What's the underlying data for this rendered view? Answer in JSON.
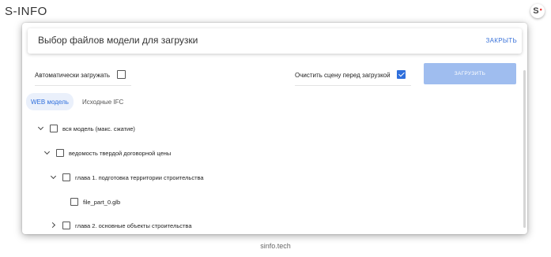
{
  "app": {
    "title": "S-INFO",
    "logo_letter": "S",
    "logo_dot": "•",
    "footer": "sinfo.tech"
  },
  "dialog": {
    "title": "Выбор файлов модели для загрузки",
    "close_label": "ЗАКРЫТЬ",
    "auto_load": {
      "label": "Автоматически загружать",
      "checked": false
    },
    "clear_scene": {
      "label": "Очистить сцену перед загрузкой",
      "checked": true
    },
    "load_button": "ЗАГРУЗИТЬ",
    "colors": {
      "accent": "#2f6fdc",
      "button_disabled": "#9fbdef"
    }
  },
  "tabs": [
    {
      "label": "WEB модель",
      "active": true
    },
    {
      "label": "Исходные IFC",
      "active": false
    }
  ],
  "tree": [
    {
      "label": "вся модель (макс. сжатие)",
      "expand": "down",
      "checked": false
    },
    {
      "label": "ведомость твердой договорной цены",
      "expand": "down",
      "checked": false
    },
    {
      "label": "глава 1. подготовка территории строительства",
      "expand": "down",
      "checked": false
    },
    {
      "label": "file_part_0.glb",
      "expand": "none",
      "checked": false
    },
    {
      "label": "глава 2. основные объекты строительства",
      "expand": "right",
      "checked": false
    }
  ]
}
